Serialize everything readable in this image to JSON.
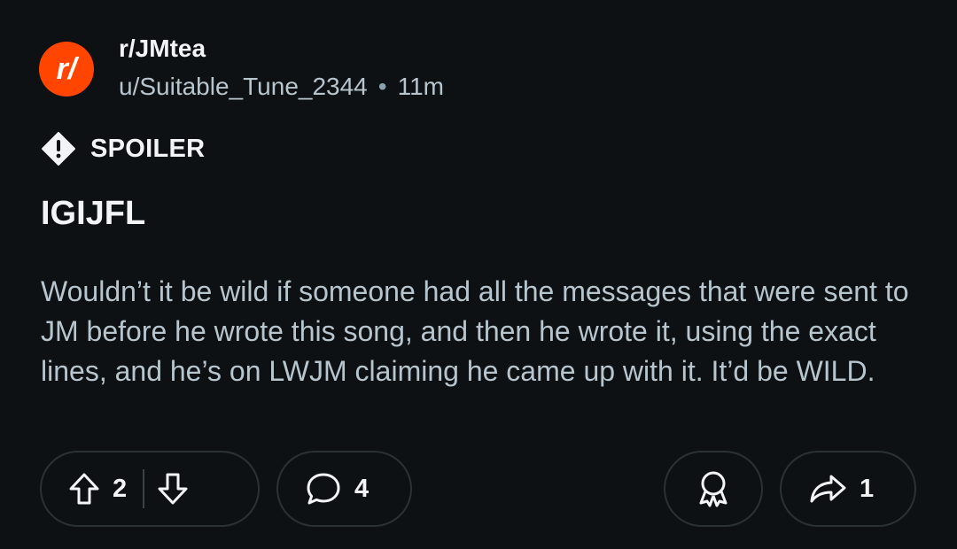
{
  "post": {
    "subreddit": "r/JMtea",
    "author": "u/Suitable_Tune_2344",
    "separator": "•",
    "age": "11m",
    "flair": "SPOILER",
    "title": "IGIJFL",
    "body": "Wouldn’t it be wild if someone had all the messages that were sent to JM before he wrote this song, and then he wrote it, using the exact lines, and he’s on LWJM claiming he came up with it. It’d be WILD."
  },
  "actions": {
    "upvote_count": "2",
    "comment_count": "4",
    "share_count": "1"
  },
  "icons": {
    "subreddit_icon": "reddit-r-slash-logo",
    "spoiler_icon": "exclamation-diamond-icon",
    "upvote_icon": "arrow-up-outline-icon",
    "downvote_icon": "arrow-down-outline-icon",
    "comment_icon": "speech-bubble-icon",
    "award_icon": "award-ribbon-icon",
    "share_icon": "share-arrow-icon"
  },
  "colors": {
    "background": "#0e1113",
    "brand_orange": "#ff4500",
    "primary_text": "#f2f4f5",
    "secondary_text": "#b7c5ce",
    "pill_border": "#2a3236"
  }
}
